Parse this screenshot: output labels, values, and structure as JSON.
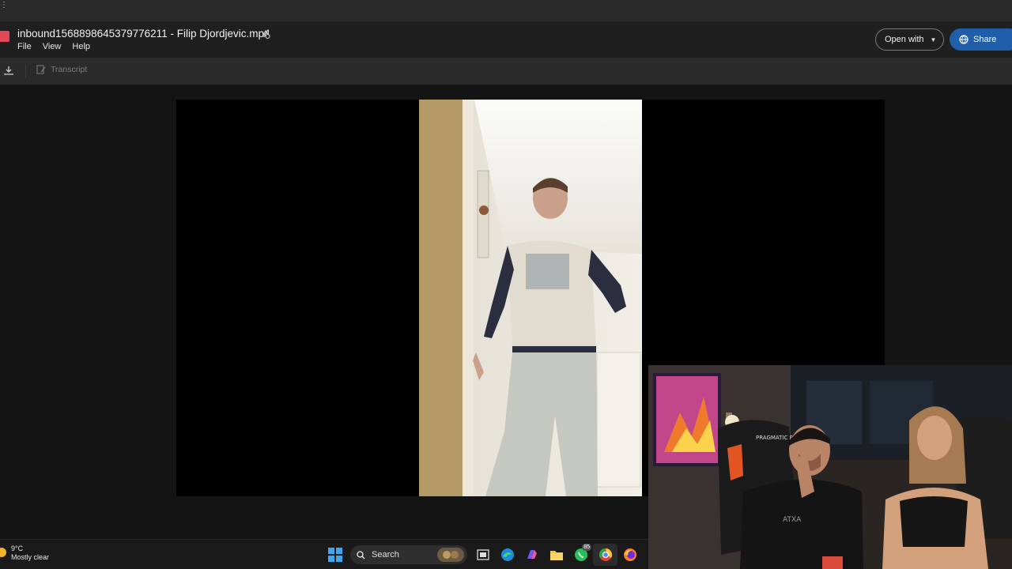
{
  "header": {
    "title": "inbound1568898645379776211 - Filip Djordjevic.mp4",
    "menu": [
      "File",
      "View",
      "Help"
    ],
    "open_with_label": "Open with",
    "share_label": "Share"
  },
  "toolbar": {
    "transcript_label": "Transcript"
  },
  "taskbar": {
    "weather_temp": "9°C",
    "weather_desc": "Mostly clear",
    "search_label": "Search",
    "whatsapp_badge": "85"
  },
  "colors": {
    "share_button": "#1f5ea8",
    "background": "#141414",
    "toolbar": "#2b2b2b"
  }
}
